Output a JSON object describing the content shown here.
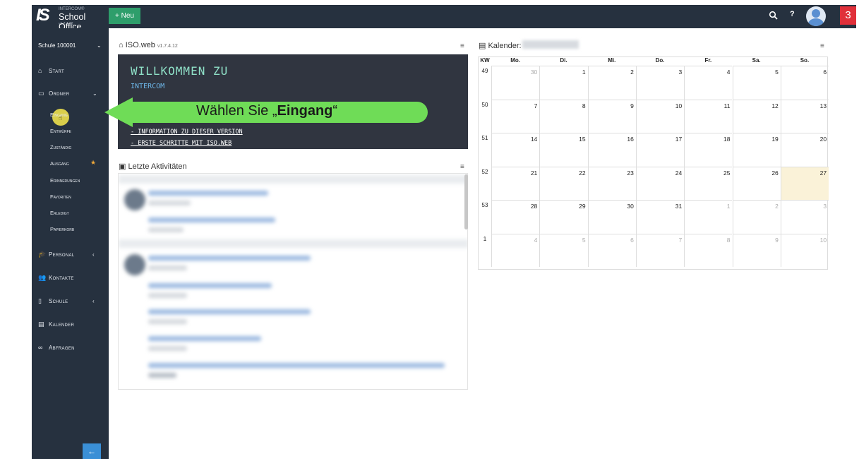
{
  "header": {
    "logo_is": "IS",
    "logo_intercom": "INTERCOM®",
    "logo_product": "School Office",
    "logo_version": "v1.7.4.12",
    "new_button": "+ Neu",
    "help": "?",
    "notification_badge": "3"
  },
  "sidebar": {
    "school_label": "Schule  100001",
    "items": [
      {
        "label": "Start",
        "icon": "home-icon"
      },
      {
        "label": "Ordner",
        "icon": "folder-open-icon"
      },
      {
        "label": "Personal",
        "icon": "graduation-cap-icon"
      },
      {
        "label": "Kontakte",
        "icon": "users-icon"
      },
      {
        "label": "Schule",
        "icon": "building-icon"
      },
      {
        "label": "Kalender",
        "icon": "calendar-icon"
      },
      {
        "label": "Abfragen",
        "icon": "binoculars-icon"
      }
    ],
    "folder_items": [
      "Eingang",
      "Entwürfe",
      "Zuständig",
      "Ausgang",
      "Erinnerungen",
      "Favoriten",
      "Erledigt",
      "Papierkorb"
    ]
  },
  "isoweb": {
    "title": "ISO.web",
    "version": "v1.7.4.12",
    "welcome": "WILLKOMMEN ZU",
    "intercom": "INTERCOM",
    "link1": "- INFORMATION ZU DIESER VERSION",
    "link2": "- ERSTE SCHRITTE MIT ISO.WEB"
  },
  "callout": {
    "prefix": "Wählen Sie „",
    "bold": "Eingang",
    "suffix": "“"
  },
  "activities": {
    "title": "Letzte Aktivitäten"
  },
  "calendar": {
    "title": "Kalender:",
    "headers": [
      "KW",
      "Mo.",
      "Di.",
      "Mi.",
      "Do.",
      "Fr.",
      "Sa.",
      "So."
    ],
    "weeks": [
      {
        "kw": "49",
        "days": [
          "30",
          "1",
          "2",
          "3",
          "4",
          "5",
          "6"
        ],
        "other": [
          0
        ]
      },
      {
        "kw": "50",
        "days": [
          "7",
          "8",
          "9",
          "10",
          "11",
          "12",
          "13"
        ],
        "other": []
      },
      {
        "kw": "51",
        "days": [
          "14",
          "15",
          "16",
          "17",
          "18",
          "19",
          "20"
        ],
        "other": []
      },
      {
        "kw": "52",
        "days": [
          "21",
          "22",
          "23",
          "24",
          "25",
          "26",
          "27"
        ],
        "other": [],
        "today": 6
      },
      {
        "kw": "53",
        "days": [
          "28",
          "29",
          "30",
          "31",
          "1",
          "2",
          "3"
        ],
        "other": [
          4,
          5,
          6
        ]
      },
      {
        "kw": "1",
        "days": [
          "4",
          "5",
          "6",
          "7",
          "8",
          "9",
          "10"
        ],
        "other": [
          0,
          1,
          2,
          3,
          4,
          5,
          6
        ]
      }
    ]
  }
}
